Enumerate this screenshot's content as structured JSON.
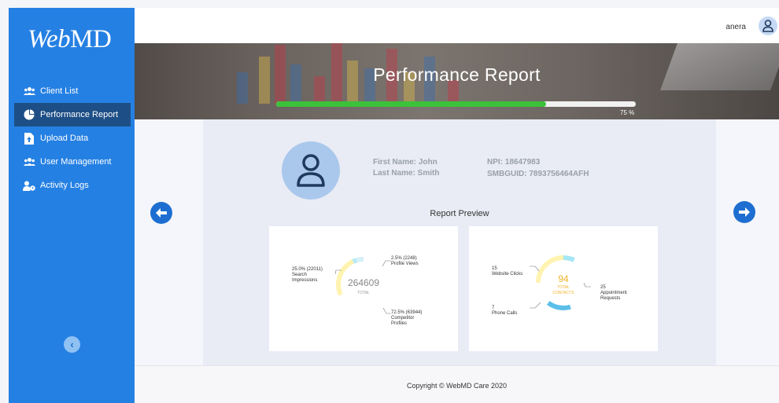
{
  "app": {
    "logo_web": "Web",
    "logo_md": "MD"
  },
  "sidebar": {
    "items": [
      {
        "label": "Client List",
        "icon": "users-icon",
        "active": false
      },
      {
        "label": "Performance Report",
        "icon": "pie-chart-icon",
        "active": true
      },
      {
        "label": "Upload Data",
        "icon": "file-upload-icon",
        "active": false
      },
      {
        "label": "User Management",
        "icon": "users-cog-icon",
        "active": false
      },
      {
        "label": "Activity Logs",
        "icon": "user-clock-icon",
        "active": false
      }
    ],
    "collapse_icon": "chevron-left-icon"
  },
  "header": {
    "username": "anera",
    "avatar_icon": "user-icon"
  },
  "banner": {
    "title": "Performance Report",
    "progress": 75,
    "progress_label": "75 %"
  },
  "profile": {
    "first_name": "First Name: John",
    "last_name": "Last Name: Smith",
    "npi": "NPI: 18647983",
    "smbguid": "SMBGUID: 7893756464AFH"
  },
  "report_preview": {
    "title": "Report Preview",
    "impressions_card": {
      "total": "264609",
      "total_label": "TOTAL",
      "segments": [
        {
          "pct_label": "25.0% (22011)",
          "name_1": "Search",
          "name_2": "Impressions",
          "fraction": 0.25,
          "color": "#fff3b0"
        },
        {
          "pct_label": "2.5% (2248)",
          "name_1": "Profile Views",
          "name_2": "",
          "fraction": 0.025,
          "color": "#b8eaf7"
        },
        {
          "pct_label": "72.5% (63944)",
          "name_1": "Competitor",
          "name_2": "Profiles",
          "fraction": 0.725,
          "color": "#d6f0f8"
        }
      ]
    },
    "contacts_card": {
      "total": "94",
      "total_label_1": "TOTAL",
      "total_label_2": "CONTACTS",
      "segments": [
        {
          "value": "15",
          "name_1": "Website Clicks",
          "name_2": "",
          "fraction": 0.16,
          "color": "#fff3b0"
        },
        {
          "value": "25",
          "name_1": "Appointment",
          "name_2": "Requests",
          "fraction": 0.266,
          "color": "#a6e6f5"
        },
        {
          "value": "7",
          "name_1": "Phone Calls",
          "name_2": "",
          "fraction": 0.074,
          "color": "#5bbfe9"
        }
      ]
    }
  },
  "footer": {
    "copyright": "Copyright © WebMD Care 2020"
  },
  "colors": {
    "sidebar": "#2580e3",
    "active_nav": "#1d4f86",
    "accent": "#1d6ed0",
    "progress": "#3cc13a"
  }
}
